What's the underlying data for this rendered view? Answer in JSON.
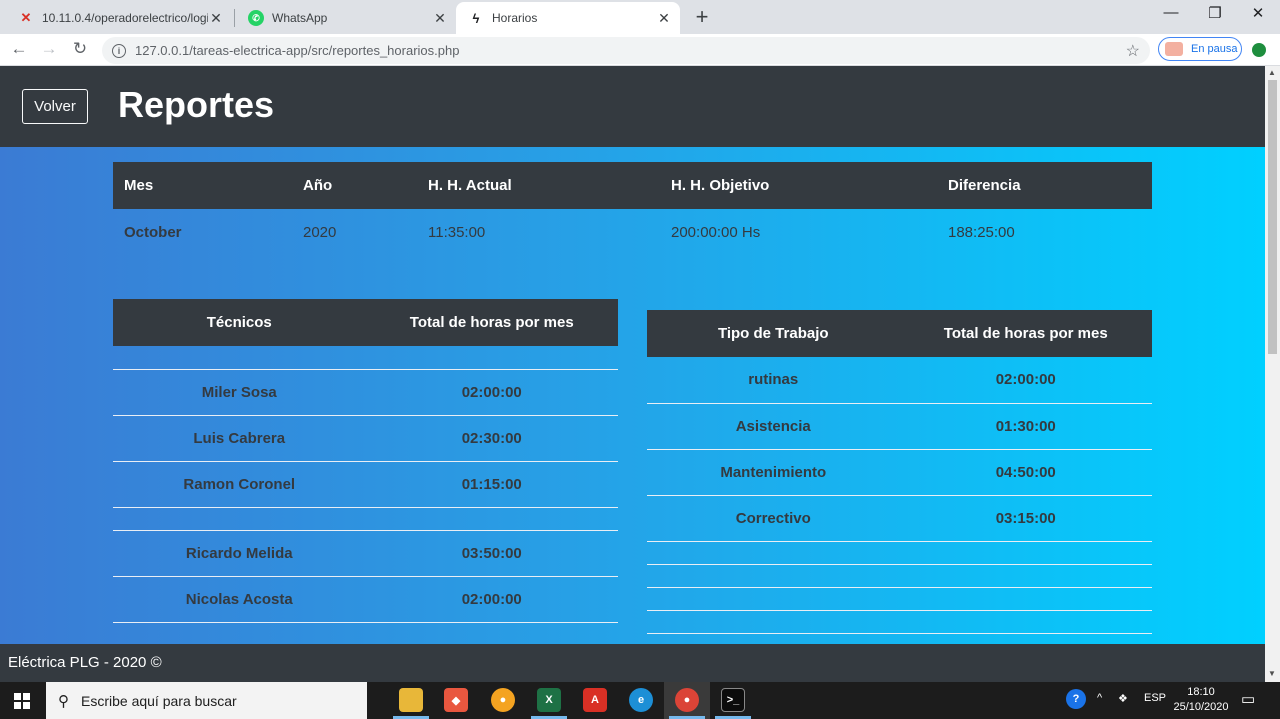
{
  "browser": {
    "tabs": [
      {
        "title": "10.11.0.4/operadorelectrico/login",
        "icon": "x-red-icon"
      },
      {
        "title": "WhatsApp",
        "icon": "whatsapp-icon"
      },
      {
        "title": "Horarios",
        "icon": "bolt-icon"
      }
    ],
    "url": "127.0.0.1/tareas-electrica-app/src/reportes_horarios.php",
    "profile_chip": "En pausa"
  },
  "header": {
    "back_label": "Volver",
    "title": "Reportes"
  },
  "summary": {
    "headers": [
      "Mes",
      "Año",
      "H. H. Actual",
      "H. H. Objetivo",
      "Diferencia"
    ],
    "row": [
      "October",
      "2020",
      "11:35:00",
      "200:00:00 Hs",
      "188:25:00"
    ]
  },
  "technicians": {
    "headers": [
      "Técnicos",
      "Total de horas por mes"
    ],
    "rows": [
      {
        "name": "Miler Sosa",
        "hours": "02:00:00"
      },
      {
        "name": "Luis Cabrera",
        "hours": "02:30:00"
      },
      {
        "name": "Ramon Coronel",
        "hours": "01:15:00"
      },
      {
        "name": "Ricardo Melida",
        "hours": "03:50:00"
      },
      {
        "name": "Nicolas Acosta",
        "hours": "02:00:00"
      }
    ]
  },
  "work_types": {
    "headers": [
      "Tipo de Trabajo",
      "Total de horas por mes"
    ],
    "rows": [
      {
        "name": "rutinas",
        "hours": "02:00:00"
      },
      {
        "name": "Asistencia",
        "hours": "01:30:00"
      },
      {
        "name": "Mantenimiento",
        "hours": "04:50:00"
      },
      {
        "name": "Correctivo",
        "hours": "03:15:00"
      }
    ]
  },
  "footer": {
    "text": "Eléctrica PLG - 2020 ©"
  },
  "taskbar": {
    "search_placeholder": "Escribe aquí para buscar",
    "language": "ESP",
    "time": "18:10",
    "date": "25/10/2020"
  }
}
